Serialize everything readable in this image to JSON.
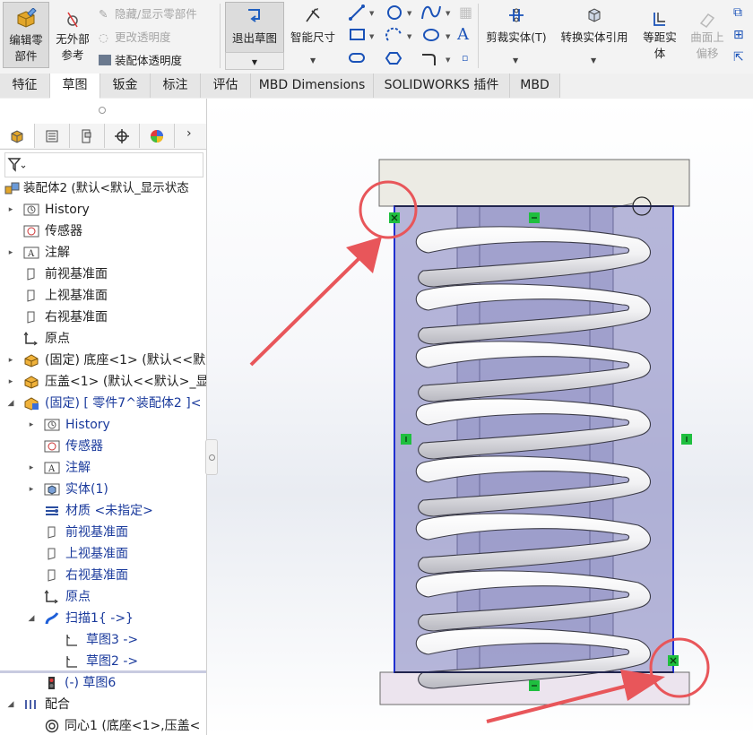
{
  "ribbon": {
    "edit_part": [
      "编辑零",
      "部件"
    ],
    "no_ext_ref": [
      "无外部",
      "参考"
    ],
    "hide_show": "隐藏/显示零部件",
    "change_transparency": "更改透明度",
    "assembly_transparency": "装配体透明度",
    "exit_sketch": "退出草图",
    "smart_dim": "智能尺寸",
    "trim": "剪裁实体(T)",
    "convert": "转换实体引用",
    "offset": [
      "等距实",
      "体"
    ],
    "surface_offset": [
      "曲面上",
      "偏移"
    ]
  },
  "tabs": [
    {
      "label": "特征"
    },
    {
      "label": "草图"
    },
    {
      "label": "钣金"
    },
    {
      "label": "标注"
    },
    {
      "label": "评估"
    },
    {
      "label": "MBD Dimensions"
    },
    {
      "label": "SOLIDWORKS 插件"
    },
    {
      "label": "MBD"
    }
  ],
  "active_tab": "草图",
  "tree": {
    "root": "装配体2  (默认<默认_显示状态",
    "items": [
      {
        "label": "History",
        "icon": "history-icon",
        "arrow": true
      },
      {
        "label": "传感器",
        "icon": "sensor-icon",
        "arrow": false
      },
      {
        "label": "注解",
        "icon": "annotation-icon",
        "arrow": true
      },
      {
        "label": "前视基准面",
        "icon": "plane-icon",
        "arrow": false
      },
      {
        "label": "上视基准面",
        "icon": "plane-icon",
        "arrow": false
      },
      {
        "label": "右视基准面",
        "icon": "plane-icon",
        "arrow": false
      },
      {
        "label": "原点",
        "icon": "origin-icon",
        "arrow": false
      },
      {
        "label": "(固定) 底座<1> (默认<<默",
        "icon": "part-icon",
        "arrow": true
      },
      {
        "label": "压盖<1> (默认<<默认>_显",
        "icon": "part-icon",
        "arrow": true
      },
      {
        "label": "(固定) [ 零件7^装配体2 ]<",
        "icon": "edit-part-icon",
        "arrow": true,
        "expanded": true,
        "blue": true
      }
    ],
    "sub_items": [
      {
        "label": "History",
        "icon": "history-icon",
        "arrow": true
      },
      {
        "label": "传感器",
        "icon": "sensor-icon",
        "arrow": false
      },
      {
        "label": "注解",
        "icon": "annotation-icon",
        "arrow": true
      },
      {
        "label": "实体(1)",
        "icon": "solid-body-icon",
        "arrow": true
      },
      {
        "label": "材质 <未指定>",
        "icon": "material-icon",
        "arrow": false
      },
      {
        "label": "前视基准面",
        "icon": "plane-icon",
        "arrow": false
      },
      {
        "label": "上视基准面",
        "icon": "plane-icon",
        "arrow": false
      },
      {
        "label": "右视基准面",
        "icon": "plane-icon",
        "arrow": false
      },
      {
        "label": "原点",
        "icon": "origin-icon",
        "arrow": false
      },
      {
        "label": "扫描1{ ->}",
        "icon": "sweep-icon",
        "arrow": true,
        "expanded": true
      }
    ],
    "sweep_children": [
      {
        "label": "草图3 ->",
        "icon": "sketch-icon"
      },
      {
        "label": "草图2 ->",
        "icon": "sketch-icon"
      }
    ],
    "sketch6": "(-) 草图6",
    "mates": "配合",
    "mate1": "同心1 (底座<1>,压盖<"
  },
  "colors": {
    "accent_blue": "#1a3a9c",
    "sketch_line": "#1f2fd0",
    "callout_red": "#e8565a",
    "handle_green": "#1fbf3f"
  }
}
